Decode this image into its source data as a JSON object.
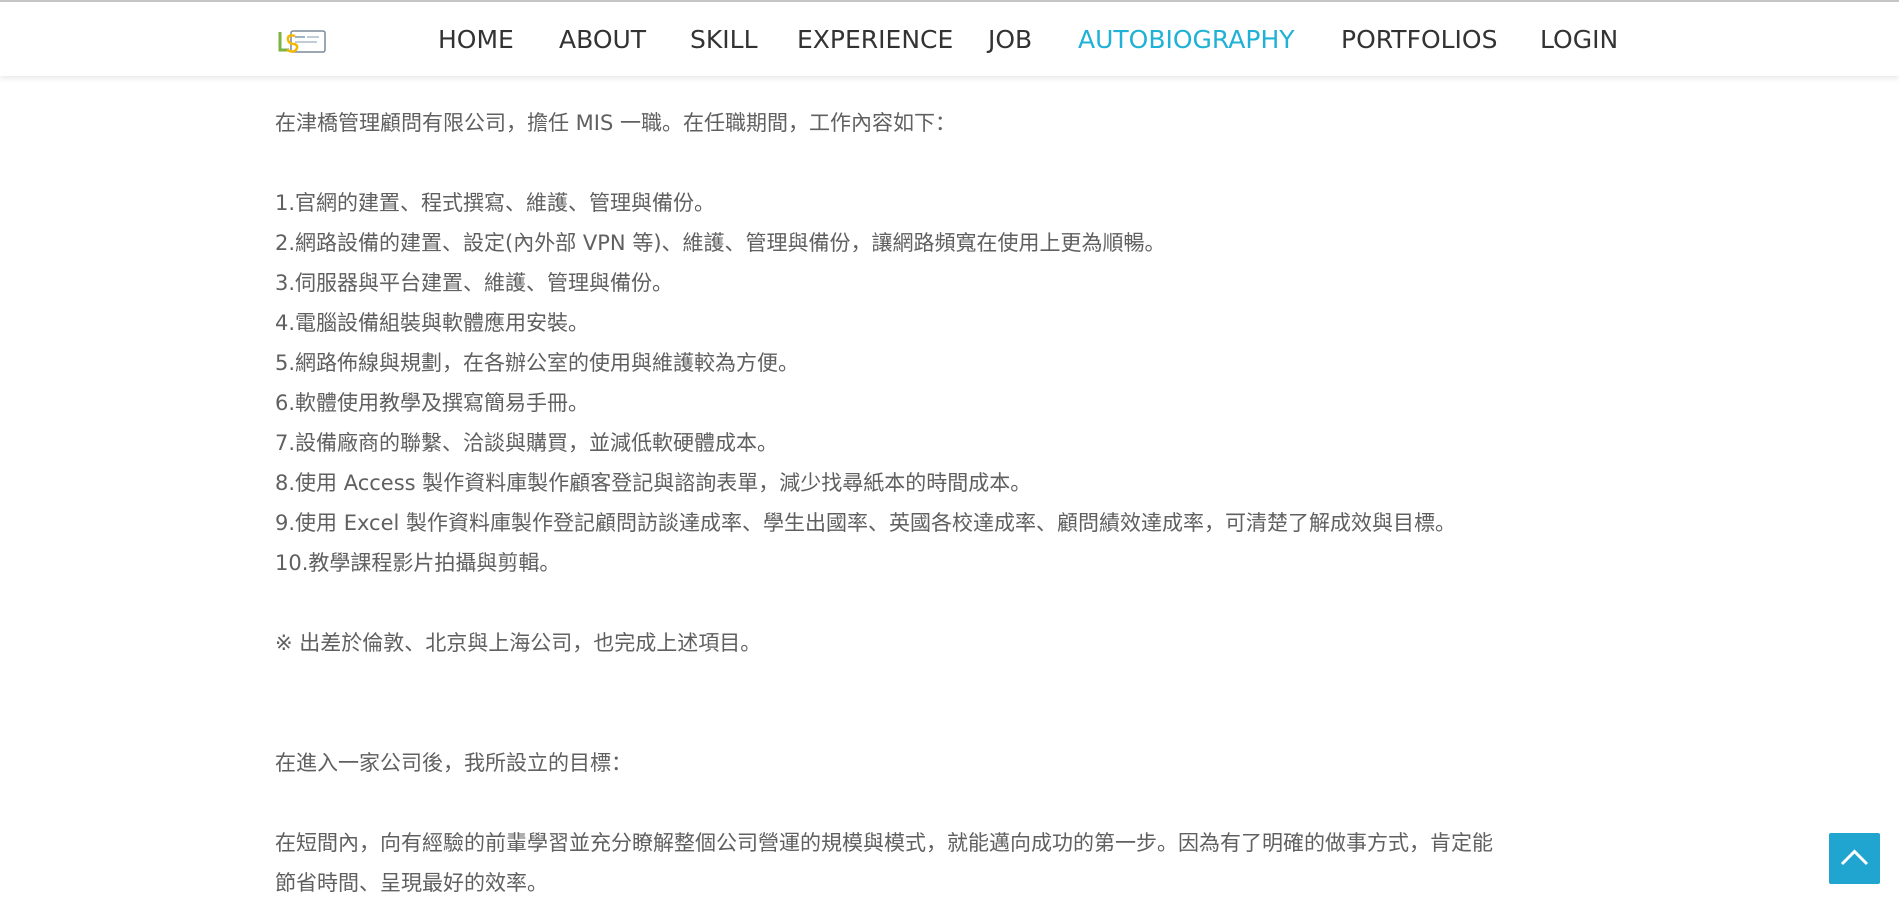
{
  "nav": {
    "logo_text": "LS",
    "items": [
      {
        "label": "HOME",
        "active": false
      },
      {
        "label": "ABOUT",
        "active": false
      },
      {
        "label": "SKILL",
        "active": false
      },
      {
        "label": "EXPERIENCE",
        "active": false
      },
      {
        "label": "JOB",
        "active": false
      },
      {
        "label": "AUTOBIOGRAPHY",
        "active": true
      },
      {
        "label": "PORTFOLIOS",
        "active": false
      },
      {
        "label": "LOGIN",
        "active": false
      }
    ],
    "active_color": "#1fb1d6"
  },
  "content": {
    "intro": "在津橋管理顧問有限公司，擔任 MIS 一職。在任職期間，工作內容如下：",
    "duties": [
      "1.官網的建置、程式撰寫、維護、管理與備份。",
      "2.網路設備的建置、設定(內外部 VPN 等)、維護、管理與備份，讓網路頻寬在使用上更為順暢。",
      "3.伺服器與平台建置、維護、管理與備份。",
      "4.電腦設備組裝與軟體應用安裝。",
      "5.網路佈線與規劃，在各辦公室的使用與維護較為方便。",
      "6.軟體使用教學及撰寫簡易手冊。",
      "7.設備廠商的聯繫、洽談與購買，並減低軟硬體成本。",
      "8.使用 Access 製作資料庫製作顧客登記與諮詢表單，減少找尋紙本的時間成本。",
      "9.使用 Excel 製作資料庫製作登記顧問訪談達成率、學生出國率、英國各校達成率、顧問績效達成率，可清楚了解成效與目標。",
      "10.教學課程影片拍攝與剪輯。"
    ],
    "note": "※ 出差於倫敦、北京與上海公司，也完成上述項目。",
    "goal_heading": "在進入一家公司後，我所設立的目標：",
    "goal_text_line1": "在短間內，向有經驗的前輩學習並充分瞭解整個公司營運的規模與模式，就能邁向成功的第一步。因為有了明確的做事方式，肯定能",
    "goal_text_line2": "節省時間、呈現最好的效率。"
  },
  "back_to_top": {
    "icon": "chevron-up-icon",
    "color": "#1fa5cf"
  }
}
